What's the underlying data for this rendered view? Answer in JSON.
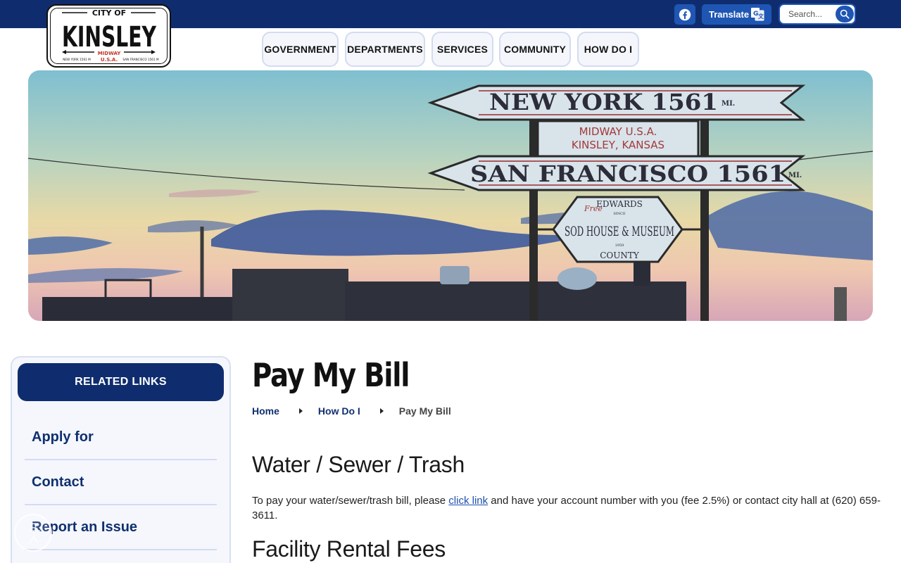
{
  "topbar": {
    "translate_label": "Translate",
    "search_placeholder": "Search..."
  },
  "logo": {
    "line1": "CITY OF",
    "line2": "KINSLEY",
    "line3": "MIDWAY",
    "line4": "U.S.A.",
    "left_caption": "NEW YORK 1561 M",
    "right_caption": "SAN FRANCISCO 1561 M"
  },
  "nav": {
    "items": [
      {
        "label": "GOVERNMENT"
      },
      {
        "label": "DEPARTMENTS"
      },
      {
        "label": "SERVICES"
      },
      {
        "label": "COMMUNITY"
      },
      {
        "label": "HOW DO I"
      }
    ]
  },
  "hero": {
    "sign_top": "NEW YORK 1561",
    "sign_top_unit": "MI.",
    "sign_mid_line1": "MIDWAY U.S.A.",
    "sign_mid_line2": "KINSLEY, KANSAS",
    "sign_bottom": "SAN FRANCISCO 1561",
    "sign_bottom_unit": "MI.",
    "museum_free": "Free",
    "museum_top": "EDWARDS",
    "museum_since": "SINCE",
    "museum_main": "SOD HOUSE & MUSEUM",
    "museum_bottom": "COUNTY",
    "museum_small": "1959"
  },
  "sidebar": {
    "header": "RELATED LINKS",
    "links": [
      {
        "label": "Apply for"
      },
      {
        "label": "Contact"
      },
      {
        "label": "Report an Issue"
      }
    ]
  },
  "main": {
    "title": "Pay My Bill",
    "breadcrumb": {
      "home": "Home",
      "parent": "How Do I",
      "current": "Pay My Bill"
    },
    "section1_heading": "Water / Sewer / Trash",
    "section1_text_before": "To pay your water/sewer/trash bill, please ",
    "section1_link": "click link",
    "section1_text_after": " and have your account number with you (fee 2.5%) or contact city hall at (620) 659-3611.",
    "section2_heading": "Facility Rental Fees"
  },
  "colors": {
    "navy": "#0f2d6e",
    "accent_blue": "#1f56b3",
    "link_blue": "#1f4faf"
  }
}
